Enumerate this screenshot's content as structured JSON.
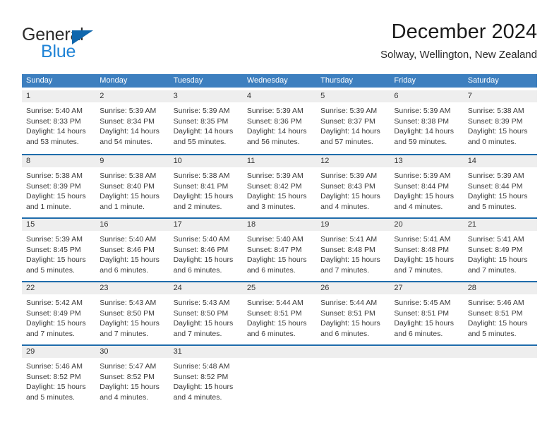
{
  "logo": {
    "word_top": "General",
    "word_bottom": "Blue",
    "triangle_color": "#1067ad",
    "blue_color": "#1f83d6"
  },
  "header": {
    "title": "December 2024",
    "location": "Solway, Wellington, New Zealand"
  },
  "theme": {
    "header_bg": "#3d7fbf",
    "week_border": "#1f6cab",
    "daynum_bg": "#eeeeee"
  },
  "weekdays": [
    "Sunday",
    "Monday",
    "Tuesday",
    "Wednesday",
    "Thursday",
    "Friday",
    "Saturday"
  ],
  "weeks": [
    [
      {
        "day": "1",
        "sunrise": "Sunrise: 5:40 AM",
        "sunset": "Sunset: 8:33 PM",
        "daylight_1": "Daylight: 14 hours",
        "daylight_2": "and 53 minutes."
      },
      {
        "day": "2",
        "sunrise": "Sunrise: 5:39 AM",
        "sunset": "Sunset: 8:34 PM",
        "daylight_1": "Daylight: 14 hours",
        "daylight_2": "and 54 minutes."
      },
      {
        "day": "3",
        "sunrise": "Sunrise: 5:39 AM",
        "sunset": "Sunset: 8:35 PM",
        "daylight_1": "Daylight: 14 hours",
        "daylight_2": "and 55 minutes."
      },
      {
        "day": "4",
        "sunrise": "Sunrise: 5:39 AM",
        "sunset": "Sunset: 8:36 PM",
        "daylight_1": "Daylight: 14 hours",
        "daylight_2": "and 56 minutes."
      },
      {
        "day": "5",
        "sunrise": "Sunrise: 5:39 AM",
        "sunset": "Sunset: 8:37 PM",
        "daylight_1": "Daylight: 14 hours",
        "daylight_2": "and 57 minutes."
      },
      {
        "day": "6",
        "sunrise": "Sunrise: 5:39 AM",
        "sunset": "Sunset: 8:38 PM",
        "daylight_1": "Daylight: 14 hours",
        "daylight_2": "and 59 minutes."
      },
      {
        "day": "7",
        "sunrise": "Sunrise: 5:38 AM",
        "sunset": "Sunset: 8:39 PM",
        "daylight_1": "Daylight: 15 hours",
        "daylight_2": "and 0 minutes."
      }
    ],
    [
      {
        "day": "8",
        "sunrise": "Sunrise: 5:38 AM",
        "sunset": "Sunset: 8:39 PM",
        "daylight_1": "Daylight: 15 hours",
        "daylight_2": "and 1 minute."
      },
      {
        "day": "9",
        "sunrise": "Sunrise: 5:38 AM",
        "sunset": "Sunset: 8:40 PM",
        "daylight_1": "Daylight: 15 hours",
        "daylight_2": "and 1 minute."
      },
      {
        "day": "10",
        "sunrise": "Sunrise: 5:38 AM",
        "sunset": "Sunset: 8:41 PM",
        "daylight_1": "Daylight: 15 hours",
        "daylight_2": "and 2 minutes."
      },
      {
        "day": "11",
        "sunrise": "Sunrise: 5:39 AM",
        "sunset": "Sunset: 8:42 PM",
        "daylight_1": "Daylight: 15 hours",
        "daylight_2": "and 3 minutes."
      },
      {
        "day": "12",
        "sunrise": "Sunrise: 5:39 AM",
        "sunset": "Sunset: 8:43 PM",
        "daylight_1": "Daylight: 15 hours",
        "daylight_2": "and 4 minutes."
      },
      {
        "day": "13",
        "sunrise": "Sunrise: 5:39 AM",
        "sunset": "Sunset: 8:44 PM",
        "daylight_1": "Daylight: 15 hours",
        "daylight_2": "and 4 minutes."
      },
      {
        "day": "14",
        "sunrise": "Sunrise: 5:39 AM",
        "sunset": "Sunset: 8:44 PM",
        "daylight_1": "Daylight: 15 hours",
        "daylight_2": "and 5 minutes."
      }
    ],
    [
      {
        "day": "15",
        "sunrise": "Sunrise: 5:39 AM",
        "sunset": "Sunset: 8:45 PM",
        "daylight_1": "Daylight: 15 hours",
        "daylight_2": "and 5 minutes."
      },
      {
        "day": "16",
        "sunrise": "Sunrise: 5:40 AM",
        "sunset": "Sunset: 8:46 PM",
        "daylight_1": "Daylight: 15 hours",
        "daylight_2": "and 6 minutes."
      },
      {
        "day": "17",
        "sunrise": "Sunrise: 5:40 AM",
        "sunset": "Sunset: 8:46 PM",
        "daylight_1": "Daylight: 15 hours",
        "daylight_2": "and 6 minutes."
      },
      {
        "day": "18",
        "sunrise": "Sunrise: 5:40 AM",
        "sunset": "Sunset: 8:47 PM",
        "daylight_1": "Daylight: 15 hours",
        "daylight_2": "and 6 minutes."
      },
      {
        "day": "19",
        "sunrise": "Sunrise: 5:41 AM",
        "sunset": "Sunset: 8:48 PM",
        "daylight_1": "Daylight: 15 hours",
        "daylight_2": "and 7 minutes."
      },
      {
        "day": "20",
        "sunrise": "Sunrise: 5:41 AM",
        "sunset": "Sunset: 8:48 PM",
        "daylight_1": "Daylight: 15 hours",
        "daylight_2": "and 7 minutes."
      },
      {
        "day": "21",
        "sunrise": "Sunrise: 5:41 AM",
        "sunset": "Sunset: 8:49 PM",
        "daylight_1": "Daylight: 15 hours",
        "daylight_2": "and 7 minutes."
      }
    ],
    [
      {
        "day": "22",
        "sunrise": "Sunrise: 5:42 AM",
        "sunset": "Sunset: 8:49 PM",
        "daylight_1": "Daylight: 15 hours",
        "daylight_2": "and 7 minutes."
      },
      {
        "day": "23",
        "sunrise": "Sunrise: 5:43 AM",
        "sunset": "Sunset: 8:50 PM",
        "daylight_1": "Daylight: 15 hours",
        "daylight_2": "and 7 minutes."
      },
      {
        "day": "24",
        "sunrise": "Sunrise: 5:43 AM",
        "sunset": "Sunset: 8:50 PM",
        "daylight_1": "Daylight: 15 hours",
        "daylight_2": "and 7 minutes."
      },
      {
        "day": "25",
        "sunrise": "Sunrise: 5:44 AM",
        "sunset": "Sunset: 8:51 PM",
        "daylight_1": "Daylight: 15 hours",
        "daylight_2": "and 6 minutes."
      },
      {
        "day": "26",
        "sunrise": "Sunrise: 5:44 AM",
        "sunset": "Sunset: 8:51 PM",
        "daylight_1": "Daylight: 15 hours",
        "daylight_2": "and 6 minutes."
      },
      {
        "day": "27",
        "sunrise": "Sunrise: 5:45 AM",
        "sunset": "Sunset: 8:51 PM",
        "daylight_1": "Daylight: 15 hours",
        "daylight_2": "and 6 minutes."
      },
      {
        "day": "28",
        "sunrise": "Sunrise: 5:46 AM",
        "sunset": "Sunset: 8:51 PM",
        "daylight_1": "Daylight: 15 hours",
        "daylight_2": "and 5 minutes."
      }
    ],
    [
      {
        "day": "29",
        "sunrise": "Sunrise: 5:46 AM",
        "sunset": "Sunset: 8:52 PM",
        "daylight_1": "Daylight: 15 hours",
        "daylight_2": "and 5 minutes."
      },
      {
        "day": "30",
        "sunrise": "Sunrise: 5:47 AM",
        "sunset": "Sunset: 8:52 PM",
        "daylight_1": "Daylight: 15 hours",
        "daylight_2": "and 4 minutes."
      },
      {
        "day": "31",
        "sunrise": "Sunrise: 5:48 AM",
        "sunset": "Sunset: 8:52 PM",
        "daylight_1": "Daylight: 15 hours",
        "daylight_2": "and 4 minutes."
      },
      {
        "day": "",
        "sunrise": "",
        "sunset": "",
        "daylight_1": "",
        "daylight_2": ""
      },
      {
        "day": "",
        "sunrise": "",
        "sunset": "",
        "daylight_1": "",
        "daylight_2": ""
      },
      {
        "day": "",
        "sunrise": "",
        "sunset": "",
        "daylight_1": "",
        "daylight_2": ""
      },
      {
        "day": "",
        "sunrise": "",
        "sunset": "",
        "daylight_1": "",
        "daylight_2": ""
      }
    ]
  ]
}
